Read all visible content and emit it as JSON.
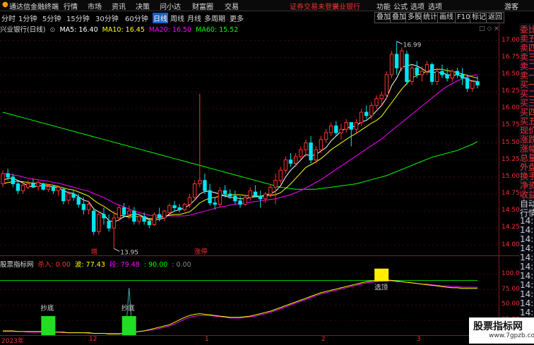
{
  "app": {
    "title": "通达信金融终端",
    "menu": [
      "行情",
      "市场",
      "资讯",
      "决策",
      "问小达",
      "财富圈",
      "交易"
    ],
    "status_notice": "证券交易未登录",
    "bank_link": "兴业银行",
    "right_menu": [
      "功能",
      "公式",
      "选项",
      "游客"
    ]
  },
  "periods": {
    "items": [
      "分时",
      "1分钟",
      "5分钟",
      "15分钟",
      "30分钟",
      "60分钟",
      "日线",
      "周线",
      "月线",
      "多周期",
      "更多"
    ],
    "active": "日线"
  },
  "right_tools": [
    "叠加",
    "叠加",
    "多股",
    "统计",
    "画线",
    "F10",
    "标记",
    "返回"
  ],
  "ma_legend": {
    "stock": "兴业银行(日线)",
    "ma5": "MA5: 16.40",
    "ma10": "MA10: 16.45",
    "ma20": "MA20: 16.50",
    "ma60": "MA60: 15.52",
    "colors": {
      "ma5": "#ffffff",
      "ma10": "#ffff00",
      "ma20": "#ff00ff",
      "ma60": "#00ff00"
    }
  },
  "indicator_legend": {
    "name": "股票指标网",
    "kill": "杀入: 0.00",
    "wave": "波: 77.43",
    "seg": "段: 79.48",
    "ninety": ": 90.00",
    "zero": ": 0.00"
  },
  "price_axis": [
    "17.00",
    "16.75",
    "16.50",
    "16.25",
    "16.00",
    "15.75",
    "15.50",
    "15.25",
    "15.00",
    "14.75",
    "14.50",
    "14.25",
    "14.00"
  ],
  "indicator_axis": [
    "100.0",
    "75.00",
    "50.00",
    "25.00"
  ],
  "annotations": {
    "high": "16.99",
    "low": "13.95",
    "zeng": "增",
    "zhangting": "涨停",
    "chaodi1": "抄底",
    "chaodi2": "抄底",
    "xuanding": "选顶"
  },
  "x_axis": [
    "2023年",
    "12",
    "1",
    "2",
    "3"
  ],
  "right_panel": [
    "委比",
    "卖五",
    "卖四",
    "卖三",
    "卖二",
    "卖一",
    "买一",
    "买二",
    "买三",
    "买四",
    "买五",
    "现价",
    "涨跌",
    "涨幅",
    "总量",
    "外盘",
    "换手",
    "净资",
    "收益",
    "自动",
    "行情",
    "14:5",
    "14:5",
    "14:5",
    "14:5",
    "14:5",
    "14:5",
    "14:5",
    "14:5",
    "14:5",
    "14:5",
    "14:5",
    "14:5",
    "14:5"
  ],
  "watermark": {
    "title": "股票指标网",
    "url": "www.7gpzb.com"
  },
  "chart_data": {
    "type": "candlestick",
    "ylim": [
      13.85,
      17.12
    ],
    "candles": [
      [
        14.9,
        15.1,
        14.85,
        15.05
      ],
      [
        15.05,
        15.12,
        14.95,
        15.0
      ],
      [
        15.0,
        15.05,
        14.85,
        14.9
      ],
      [
        14.9,
        14.95,
        14.75,
        14.8
      ],
      [
        14.8,
        14.92,
        14.75,
        14.88
      ],
      [
        14.85,
        14.95,
        14.82,
        14.9
      ],
      [
        14.9,
        14.98,
        14.84,
        14.86
      ],
      [
        14.86,
        14.95,
        14.8,
        14.92
      ],
      [
        14.9,
        14.92,
        14.8,
        14.82
      ],
      [
        14.82,
        14.9,
        14.78,
        14.86
      ],
      [
        14.86,
        14.88,
        14.75,
        14.8
      ],
      [
        14.8,
        14.88,
        14.72,
        14.85
      ],
      [
        14.82,
        14.85,
        14.6,
        14.65
      ],
      [
        14.66,
        14.8,
        14.6,
        14.75
      ],
      [
        14.75,
        14.8,
        14.65,
        14.7
      ],
      [
        14.7,
        14.75,
        14.55,
        14.6
      ],
      [
        14.6,
        14.7,
        14.45,
        14.52
      ],
      [
        14.52,
        14.65,
        14.45,
        14.6
      ],
      [
        14.5,
        14.55,
        14.15,
        14.2
      ],
      [
        14.2,
        14.5,
        14.15,
        14.45
      ],
      [
        14.45,
        14.55,
        14.3,
        14.4
      ],
      [
        14.35,
        14.45,
        14.2,
        14.25
      ],
      [
        14.25,
        14.5,
        13.95,
        14.4
      ],
      [
        14.4,
        14.6,
        14.35,
        14.55
      ],
      [
        14.55,
        14.62,
        14.4,
        14.45
      ],
      [
        14.45,
        14.58,
        14.38,
        14.5
      ],
      [
        14.5,
        14.56,
        14.3,
        14.35
      ],
      [
        14.35,
        14.45,
        14.3,
        14.42
      ],
      [
        14.42,
        14.48,
        14.3,
        14.35
      ],
      [
        14.35,
        14.4,
        14.25,
        14.3
      ],
      [
        14.3,
        14.48,
        14.28,
        14.45
      ],
      [
        14.45,
        14.55,
        14.35,
        14.4
      ],
      [
        14.4,
        14.52,
        14.35,
        14.5
      ],
      [
        14.48,
        14.62,
        14.45,
        14.58
      ],
      [
        14.58,
        14.65,
        14.5,
        14.55
      ],
      [
        14.55,
        14.6,
        14.48,
        14.52
      ],
      [
        14.52,
        14.62,
        14.5,
        14.6
      ],
      [
        14.6,
        14.75,
        14.55,
        14.7
      ],
      [
        14.7,
        14.95,
        14.65,
        14.9
      ],
      [
        14.9,
        16.22,
        14.85,
        14.95
      ],
      [
        14.95,
        15.05,
        14.75,
        14.8
      ],
      [
        14.8,
        14.9,
        14.58,
        14.62
      ],
      [
        14.62,
        14.7,
        14.52,
        14.6
      ],
      [
        14.6,
        14.85,
        14.55,
        14.8
      ],
      [
        14.8,
        14.88,
        14.7,
        14.75
      ],
      [
        14.75,
        14.82,
        14.68,
        14.72
      ],
      [
        14.72,
        14.8,
        14.6,
        14.65
      ],
      [
        14.65,
        14.72,
        14.55,
        14.6
      ],
      [
        14.6,
        14.72,
        14.58,
        14.7
      ],
      [
        14.7,
        14.85,
        14.65,
        14.8
      ],
      [
        14.78,
        14.88,
        14.7,
        14.72
      ],
      [
        14.72,
        14.8,
        14.55,
        14.68
      ],
      [
        14.68,
        14.78,
        14.62,
        14.75
      ],
      [
        14.75,
        14.9,
        14.7,
        14.85
      ],
      [
        14.85,
        15.05,
        14.6,
        14.95
      ],
      [
        14.95,
        15.15,
        14.9,
        15.1
      ],
      [
        15.1,
        15.3,
        15.05,
        15.25
      ],
      [
        15.25,
        15.35,
        15.15,
        15.2
      ],
      [
        15.2,
        15.35,
        15.15,
        15.3
      ],
      [
        15.3,
        15.45,
        15.25,
        15.4
      ],
      [
        15.4,
        15.55,
        15.3,
        15.5
      ],
      [
        15.5,
        15.6,
        15.2,
        15.25
      ],
      [
        15.25,
        15.45,
        15.2,
        15.4
      ],
      [
        15.4,
        15.6,
        15.35,
        15.55
      ],
      [
        15.55,
        15.7,
        15.5,
        15.65
      ],
      [
        15.65,
        15.8,
        15.6,
        15.75
      ],
      [
        15.75,
        15.82,
        15.6,
        15.65
      ],
      [
        15.65,
        15.78,
        15.55,
        15.7
      ],
      [
        15.7,
        15.85,
        15.65,
        15.8
      ],
      [
        15.8,
        15.78,
        15.45,
        15.7
      ],
      [
        15.7,
        15.85,
        15.65,
        15.8
      ],
      [
        15.8,
        16.0,
        15.75,
        15.95
      ],
      [
        15.95,
        16.05,
        15.85,
        15.9
      ],
      [
        15.9,
        16.1,
        15.85,
        16.05
      ],
      [
        16.05,
        16.2,
        16.0,
        16.15
      ],
      [
        16.15,
        16.25,
        16.05,
        16.2
      ],
      [
        16.2,
        16.55,
        16.15,
        16.5
      ],
      [
        16.5,
        16.85,
        16.45,
        16.8
      ],
      [
        16.8,
        16.99,
        16.5,
        16.6
      ],
      [
        16.6,
        16.9,
        16.55,
        16.85
      ],
      [
        16.8,
        16.85,
        16.35,
        16.4
      ],
      [
        16.4,
        16.65,
        16.35,
        16.6
      ],
      [
        16.6,
        16.7,
        16.45,
        16.5
      ],
      [
        16.5,
        16.62,
        16.4,
        16.55
      ],
      [
        16.55,
        16.7,
        16.5,
        16.65
      ],
      [
        16.65,
        16.68,
        16.35,
        16.4
      ],
      [
        16.4,
        16.6,
        16.35,
        16.55
      ],
      [
        16.55,
        16.65,
        16.45,
        16.5
      ],
      [
        16.5,
        16.6,
        16.4,
        16.45
      ],
      [
        16.45,
        16.58,
        16.4,
        16.55
      ],
      [
        16.55,
        16.6,
        16.45,
        16.5
      ],
      [
        16.5,
        16.6,
        16.35,
        16.45
      ],
      [
        16.45,
        16.5,
        16.25,
        16.3
      ],
      [
        16.3,
        16.42,
        16.25,
        16.4
      ],
      [
        16.4,
        16.48,
        16.3,
        16.35
      ]
    ],
    "ma5": [
      14.95,
      14.98,
      14.98,
      14.95,
      14.91,
      14.87,
      14.85,
      14.87,
      14.87,
      14.87,
      14.85,
      14.85,
      14.8,
      14.77,
      14.76,
      14.71,
      14.66,
      14.64,
      14.53,
      14.49,
      14.45,
      14.36,
      14.34,
      14.37,
      14.42,
      14.43,
      14.46,
      14.45,
      14.41,
      14.37,
      14.37,
      14.38,
      14.4,
      14.46,
      14.5,
      14.52,
      14.55,
      14.59,
      14.66,
      14.75,
      14.79,
      14.79,
      14.77,
      14.75,
      14.72,
      14.7,
      14.7,
      14.68,
      14.68,
      14.7,
      14.71,
      14.71,
      14.73,
      14.76,
      14.79,
      14.87,
      15.0,
      15.1,
      15.17,
      15.25,
      15.33,
      15.31,
      15.33,
      15.38,
      15.43,
      15.53,
      15.6,
      15.67,
      15.72,
      15.73,
      15.75,
      15.81,
      15.83,
      15.89,
      15.97,
      16.05,
      16.16,
      16.34,
      16.45,
      16.61,
      16.63,
      16.65,
      16.63,
      16.59,
      16.54,
      16.54,
      16.53,
      16.53,
      16.5,
      16.49,
      16.5,
      16.47,
      16.43,
      16.41,
      16.4
    ],
    "ma10": [
      14.9,
      14.92,
      14.93,
      14.94,
      14.93,
      14.92,
      14.91,
      14.91,
      14.9,
      14.89,
      14.88,
      14.86,
      14.84,
      14.82,
      14.81,
      14.78,
      14.75,
      14.72,
      14.66,
      14.61,
      14.57,
      14.52,
      14.47,
      14.44,
      14.43,
      14.41,
      14.42,
      14.42,
      14.41,
      14.39,
      14.39,
      14.41,
      14.42,
      14.44,
      14.45,
      14.45,
      14.47,
      14.49,
      14.55,
      14.62,
      14.66,
      14.69,
      14.7,
      14.72,
      14.73,
      14.74,
      14.74,
      14.74,
      14.73,
      14.72,
      14.72,
      14.72,
      14.73,
      14.73,
      14.74,
      14.77,
      14.83,
      14.9,
      14.98,
      15.06,
      15.14,
      15.18,
      15.22,
      15.27,
      15.33,
      15.4,
      15.45,
      15.5,
      15.55,
      15.6,
      15.64,
      15.69,
      15.74,
      15.79,
      15.83,
      15.89,
      15.99,
      16.09,
      16.19,
      16.29,
      16.37,
      16.45,
      16.49,
      16.52,
      16.55,
      16.57,
      16.58,
      16.58,
      16.56,
      16.55,
      16.53,
      16.51,
      16.49,
      16.47,
      16.45
    ],
    "ma20": [
      15.05,
      15.04,
      15.03,
      15.02,
      15.0,
      14.98,
      14.97,
      14.96,
      14.95,
      14.94,
      14.92,
      14.91,
      14.89,
      14.87,
      14.85,
      14.83,
      14.81,
      14.79,
      14.76,
      14.73,
      14.7,
      14.66,
      14.62,
      14.59,
      14.56,
      14.53,
      14.5,
      14.48,
      14.46,
      14.44,
      14.43,
      14.43,
      14.43,
      14.43,
      14.43,
      14.43,
      14.43,
      14.44,
      14.46,
      14.48,
      14.5,
      14.52,
      14.54,
      14.56,
      14.57,
      14.59,
      14.6,
      14.61,
      14.62,
      14.63,
      14.64,
      14.65,
      14.66,
      14.67,
      14.68,
      14.7,
      14.72,
      14.74,
      14.77,
      14.8,
      14.84,
      14.88,
      14.92,
      14.96,
      15.01,
      15.06,
      15.11,
      15.16,
      15.21,
      15.26,
      15.31,
      15.36,
      15.41,
      15.46,
      15.51,
      15.56,
      15.62,
      15.68,
      15.74,
      15.8,
      15.86,
      15.92,
      15.98,
      16.04,
      16.1,
      16.16,
      16.22,
      16.28,
      16.33,
      16.37,
      16.41,
      16.44,
      16.47,
      16.49,
      16.5
    ],
    "ma60": [
      15.95,
      15.93,
      15.91,
      15.89,
      15.87,
      15.85,
      15.83,
      15.81,
      15.79,
      15.77,
      15.75,
      15.73,
      15.71,
      15.69,
      15.67,
      15.65,
      15.63,
      15.61,
      15.59,
      15.57,
      15.55,
      15.53,
      15.51,
      15.49,
      15.47,
      15.45,
      15.43,
      15.41,
      15.39,
      15.37,
      15.35,
      15.33,
      15.31,
      15.29,
      15.27,
      15.25,
      15.23,
      15.21,
      15.19,
      15.17,
      15.15,
      15.13,
      15.11,
      15.09,
      15.07,
      15.05,
      15.03,
      15.01,
      14.99,
      14.97,
      14.95,
      14.93,
      14.91,
      14.89,
      14.87,
      14.85,
      14.84,
      14.83,
      14.82,
      14.82,
      14.82,
      14.82,
      14.82,
      14.83,
      14.84,
      14.85,
      14.86,
      14.87,
      14.88,
      14.89,
      14.9,
      14.92,
      14.94,
      14.96,
      14.98,
      15.0,
      15.02,
      15.05,
      15.08,
      15.11,
      15.14,
      15.17,
      15.2,
      15.23,
      15.26,
      15.29,
      15.31,
      15.33,
      15.35,
      15.37,
      15.39,
      15.42,
      15.45,
      15.48,
      15.52
    ],
    "indicator": {
      "ylim": [
        0,
        110
      ],
      "wave": [
        8,
        8,
        8,
        7,
        7,
        7,
        7,
        7,
        7,
        7,
        6,
        6,
        6,
        5,
        5,
        5,
        5,
        5,
        4,
        4,
        4,
        3,
        3,
        3,
        4,
        5,
        6,
        7,
        8,
        10,
        12,
        14,
        16,
        18,
        22,
        26,
        30,
        33,
        35,
        36,
        35,
        34,
        33,
        32,
        31,
        30,
        30,
        30,
        31,
        32,
        34,
        36,
        38,
        40,
        43,
        46,
        49,
        52,
        55,
        58,
        61,
        64,
        67,
        70,
        72,
        74,
        76,
        78,
        80,
        82,
        84,
        86,
        88,
        89,
        90,
        91,
        91,
        90,
        89,
        88,
        87,
        86,
        85,
        84,
        83,
        82,
        81,
        80,
        79,
        78,
        78,
        77,
        77,
        77,
        77
      ],
      "seg": [
        7,
        7,
        7,
        7,
        7,
        6,
        6,
        6,
        6,
        6,
        6,
        6,
        5,
        5,
        5,
        5,
        5,
        4,
        4,
        4,
        4,
        4,
        4,
        4,
        4,
        5,
        6,
        7,
        8,
        9,
        10,
        12,
        14,
        16,
        19,
        23,
        27,
        30,
        32,
        33,
        33,
        33,
        32,
        31,
        30,
        29,
        29,
        29,
        30,
        31,
        32,
        34,
        36,
        38,
        41,
        44,
        47,
        50,
        53,
        56,
        59,
        62,
        65,
        68,
        70,
        72,
        74,
        76,
        78,
        80,
        82,
        84,
        86,
        87,
        88,
        89,
        89,
        89,
        88,
        88,
        87,
        86,
        85,
        84,
        84,
        83,
        82,
        81,
        81,
        80,
        80,
        79,
        79,
        79,
        79
      ],
      "line_level": 90,
      "buy_markers": [
        9,
        25
      ],
      "sell_marker": 75
    }
  }
}
